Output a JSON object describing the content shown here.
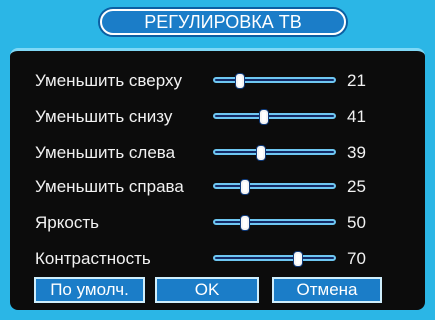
{
  "dialog": {
    "title": "РЕГУЛИРОВКА ТВ"
  },
  "settings": [
    {
      "label": "Уменьшить сверху",
      "value": "21",
      "fraction": 0.21
    },
    {
      "label": "Уменьшить снизу",
      "value": "41",
      "fraction": 0.41
    },
    {
      "label": "Уменьшить слева",
      "value": "39",
      "fraction": 0.39
    },
    {
      "label": "Уменьшить справа",
      "value": "25",
      "fraction": 0.25
    },
    {
      "label": "Яркость",
      "value": "50",
      "fraction": 0.25
    },
    {
      "label": "Контрастность",
      "value": "70",
      "fraction": 0.7
    }
  ],
  "buttons": {
    "default_label": "По умолч.",
    "ok_label": "OK",
    "cancel_label": "Отмена"
  },
  "colors": {
    "frame": "#2bb6e6",
    "background": "#0c0c0c",
    "accent": "#1b7dc8"
  }
}
